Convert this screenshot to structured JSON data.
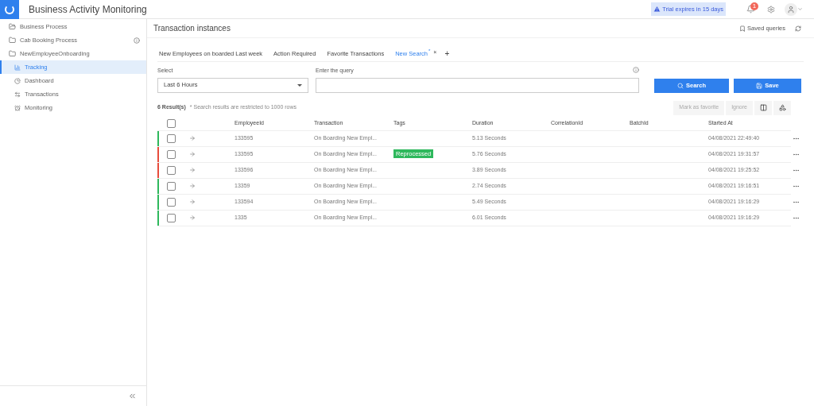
{
  "app": {
    "title": "Business Activity Monitoring",
    "trial": "Trial expires in 15 days",
    "notifications": "1"
  },
  "sidebar": {
    "items": [
      {
        "label": "Business Process",
        "info": false,
        "selected": false
      },
      {
        "label": "Cab Booking Process",
        "info": true,
        "selected": false
      },
      {
        "label": "NewEmployeeOnboarding",
        "info": false,
        "selected": false,
        "children": [
          {
            "label": "Tracking",
            "selected": true
          },
          {
            "label": "Dashboard",
            "selected": false
          },
          {
            "label": "Transactions",
            "selected": false
          },
          {
            "label": "Monitoring",
            "selected": false
          }
        ]
      }
    ]
  },
  "page": {
    "title": "Transaction instances",
    "saved_queries": "Saved queries"
  },
  "tabs": [
    {
      "label": "New Employees on boarded Last week",
      "selected": false,
      "modified": false,
      "closable": false
    },
    {
      "label": "Action Required",
      "selected": false,
      "modified": false,
      "closable": false
    },
    {
      "label": "Favorite Transactions",
      "selected": false,
      "modified": false,
      "closable": false
    },
    {
      "label": "New Search",
      "selected": true,
      "modified": true,
      "closable": true
    }
  ],
  "tab_marks": {
    "modified": "*",
    "close": "×",
    "add": "+"
  },
  "query": {
    "select_label": "Select",
    "select_value": "Last 6 Hours",
    "query_label": "Enter the query",
    "search": "Search",
    "save": "Save"
  },
  "results": {
    "count": "6 Result(s)",
    "note": "* Search results are restricted to 1000 rows"
  },
  "actions": [
    {
      "label": "Mark as favorite",
      "disabled": true
    },
    {
      "label": "Ignore",
      "disabled": true
    }
  ],
  "table": {
    "columns": [
      "EmployeeId",
      "Transaction",
      "Tags",
      "Duration",
      "CorrelationId",
      "BatchId",
      "Started At"
    ],
    "rows": [
      {
        "color": "#2eb85c",
        "checked": false,
        "employee_id": "133595",
        "transaction": "On Boarding New Empl...",
        "tag": "",
        "duration": "5.13 Seconds",
        "started_at": "04/08/2021 22:49:40"
      },
      {
        "color": "#e74c3c",
        "checked": false,
        "employee_id": "133595",
        "transaction": "On Boarding New Empl...",
        "tag": "Reprocessed",
        "duration": "5.76 Seconds",
        "started_at": "04/08/2021 19:31:57"
      },
      {
        "color": "#e74c3c",
        "checked": false,
        "employee_id": "133596",
        "transaction": "On Boarding New Empl...",
        "tag": "",
        "duration": "3.89 Seconds",
        "started_at": "04/08/2021 19:25:52"
      },
      {
        "color": "#2eb85c",
        "checked": false,
        "employee_id": "13359",
        "transaction": "On Boarding New Empl...",
        "tag": "",
        "duration": "2.74 Seconds",
        "started_at": "04/08/2021 19:16:51"
      },
      {
        "color": "#2eb85c",
        "checked": false,
        "employee_id": "133594",
        "transaction": "On Boarding New Empl...",
        "tag": "",
        "duration": "5.49 Seconds",
        "started_at": "04/08/2021 19:16:29"
      },
      {
        "color": "#2eb85c",
        "checked": false,
        "employee_id": "1335",
        "transaction": "On Boarding New Empl...",
        "tag": "",
        "duration": "6.01 Seconds",
        "started_at": "04/08/2021 19:16:29"
      }
    ]
  },
  "all_checked": false
}
